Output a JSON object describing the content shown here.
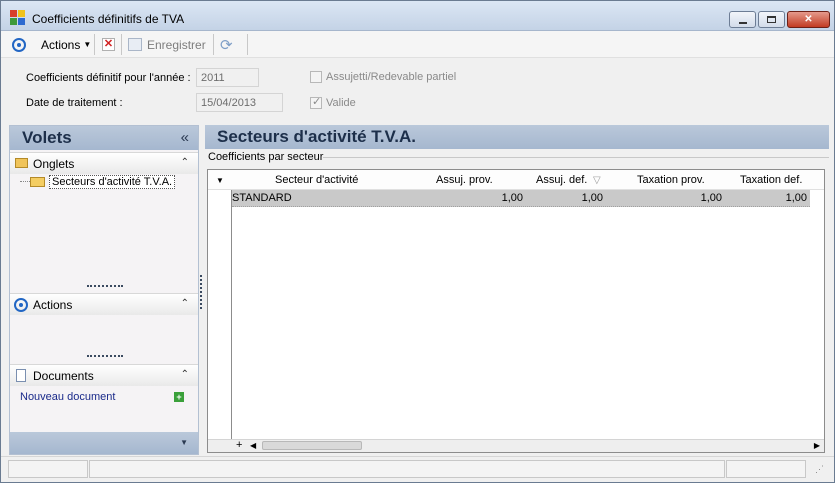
{
  "window": {
    "title": "Coefficients définitifs de TVA",
    "icons": [
      "minimize-icon",
      "maximize-icon",
      "close-icon"
    ]
  },
  "toolbar": {
    "actions_label": "Actions",
    "save_label": "Enregistrer"
  },
  "form": {
    "year_label": "Coefficients définitif pour l'année :",
    "year_value": "2011",
    "date_label": "Date de traitement :",
    "date_value": "15/04/2013",
    "partial_label": "Assujetti/Redevable partiel",
    "valid_label": "Valide",
    "valid_checked": true,
    "partial_checked": false
  },
  "left": {
    "title": "Volets",
    "collapse_glyph": "«",
    "tabs_title": "Onglets",
    "tabs_items": [
      "Secteurs d'activité T.V.A."
    ],
    "actions_title": "Actions",
    "documents_title": "Documents",
    "new_document": "Nouveau document"
  },
  "right": {
    "title": "Secteurs d'activité T.V.A.",
    "group_caption": "Coefficients par secteur",
    "columns": [
      "Secteur d'activité",
      "Assuj. prov.",
      "Assuj. def.",
      "Taxation prov.",
      "Taxation def."
    ],
    "rows": [
      {
        "sector": "STANDARD",
        "assuj_prov": "1,00",
        "assuj_def": "1,00",
        "tax_prov": "1,00",
        "tax_def": "1,00"
      }
    ],
    "add_glyph": "+"
  },
  "colors": {
    "header_blue": "#a5b7cf",
    "accent_blue": "#2266c4",
    "row_selected": "#c9c9c9"
  }
}
